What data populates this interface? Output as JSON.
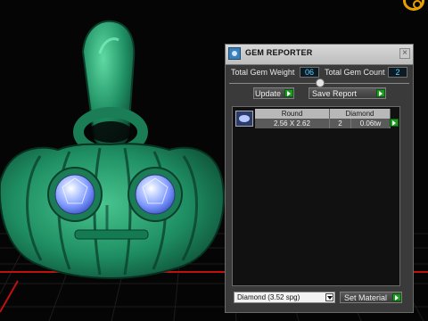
{
  "window": {
    "title": "GEM REPORTER",
    "close_symbol": "×"
  },
  "stats": {
    "total_weight_label": "Total Gem Weight",
    "total_weight_value": "06",
    "total_count_label": "Total Gem Count",
    "total_count_value": "2"
  },
  "buttons": {
    "update_label": "Update",
    "save_report_label": "Save Report",
    "set_material_label": "Set Material"
  },
  "gem_table": {
    "headers": [
      "Round",
      "Diamond"
    ],
    "rows": [
      {
        "dimensions": "2.56 X 2.62",
        "count": "2",
        "weight": "0.06tw"
      }
    ]
  },
  "material_select": {
    "value": "Diamond    (3.52 spg)"
  },
  "colors": {
    "model_green": "#1f8f63",
    "panel_bg": "#3a3a3a",
    "accent_value": "#63d1ff",
    "grid_red": "#c01010",
    "play_button": "#1e9a23",
    "gem_blue": "#8ea8ff",
    "corner_ring": "#e8a000"
  },
  "icons": {
    "window_icon": "gem-reporter-icon",
    "close": "close-icon",
    "play": "play-icon",
    "gem": "round-gem-icon",
    "dropdown": "chevron-down-icon"
  }
}
